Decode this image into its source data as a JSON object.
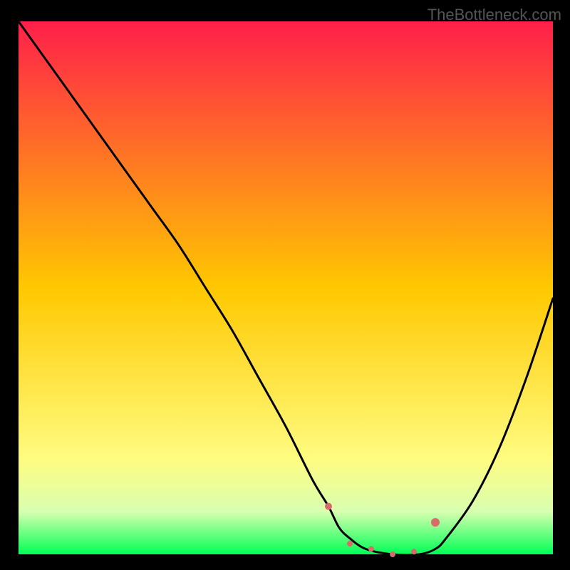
{
  "watermark": "TheBottleneck.com",
  "chart_data": {
    "type": "line",
    "title": "",
    "xlabel": "",
    "ylabel": "",
    "xlim": [
      0,
      100
    ],
    "ylim": [
      0,
      100
    ],
    "grid": false,
    "legend": false,
    "background": {
      "type": "vertical-gradient",
      "stops": [
        {
          "offset": 0,
          "color": "#ff1f4a"
        },
        {
          "offset": 50,
          "color": "#ffc800"
        },
        {
          "offset": 82,
          "color": "#fffc80"
        },
        {
          "offset": 92,
          "color": "#d8ffb0"
        },
        {
          "offset": 100,
          "color": "#00ff55"
        }
      ]
    },
    "series": [
      {
        "name": "bottleneck-curve",
        "color": "#000000",
        "x": [
          0,
          5,
          10,
          15,
          20,
          25,
          30,
          35,
          40,
          45,
          50,
          55,
          58,
          60,
          62,
          65,
          70,
          75,
          78,
          80,
          85,
          90,
          95,
          100
        ],
        "y": [
          100,
          93,
          86,
          79,
          72,
          65,
          58,
          50,
          42,
          33,
          24,
          14,
          9,
          5,
          3,
          1,
          0,
          0,
          1,
          3,
          10,
          20,
          33,
          48
        ]
      }
    ],
    "markers": [
      {
        "name": "fit-start",
        "x": 58,
        "y": 9,
        "color": "#d86a6a",
        "radius": 5
      },
      {
        "name": "fit-a",
        "x": 62,
        "y": 2,
        "color": "#d86a6a",
        "radius": 4
      },
      {
        "name": "fit-b",
        "x": 66,
        "y": 1,
        "color": "#d86a6a",
        "radius": 4
      },
      {
        "name": "fit-c",
        "x": 70,
        "y": 0,
        "color": "#d86a6a",
        "radius": 4
      },
      {
        "name": "fit-d",
        "x": 74,
        "y": 0.5,
        "color": "#d86a6a",
        "radius": 4
      },
      {
        "name": "fit-end",
        "x": 78,
        "y": 6,
        "color": "#d86a6a",
        "radius": 6
      }
    ]
  }
}
